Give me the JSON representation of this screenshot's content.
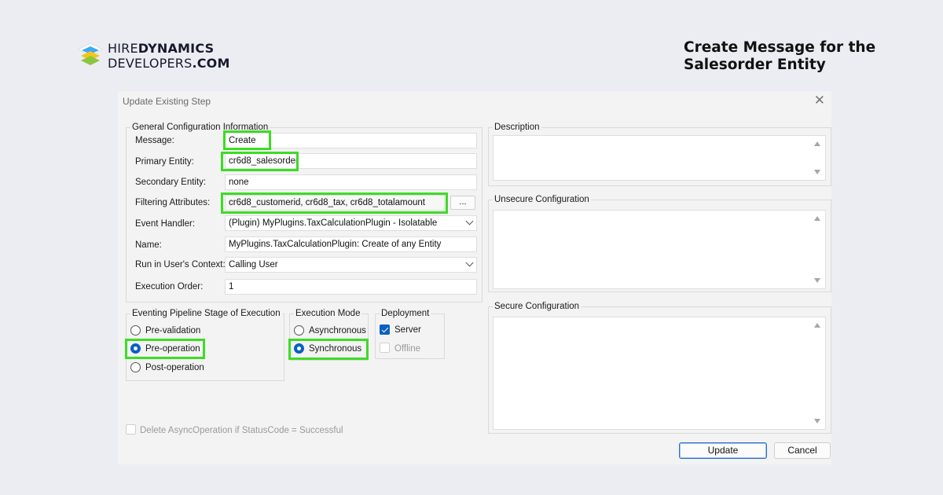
{
  "brand": {
    "line1_a": "HIRE",
    "line1_b": "DYNAMICS",
    "line2_a": "DEVELOPERS",
    "line2_b": ".COM"
  },
  "headline": "Create Message for the Salesorder Entity",
  "dialog": {
    "title": "Update Existing Step",
    "close_glyph": "✕",
    "general": {
      "legend": "General Configuration Information",
      "message_label": "Message:",
      "message_value": "Create",
      "primary_label": "Primary Entity:",
      "primary_value": "cr6d8_salesorder",
      "secondary_label": "Secondary Entity:",
      "secondary_value": "none",
      "filtering_label": "Filtering Attributes:",
      "filtering_value": "cr6d8_customerid, cr6d8_tax, cr6d8_totalamount",
      "filtering_button": "...",
      "handler_label": "Event Handler:",
      "handler_value": "(Plugin) MyPlugins.TaxCalculationPlugin - Isolatable",
      "name_label": "Name:",
      "name_value": "MyPlugins.TaxCalculationPlugin: Create of any Entity",
      "context_label": "Run in User's Context:",
      "context_value": "Calling User",
      "order_label": "Execution Order:",
      "order_value": "1"
    },
    "pipeline": {
      "legend": "Eventing Pipeline Stage of Execution",
      "options": [
        "Pre-validation",
        "Pre-operation",
        "Post-operation"
      ],
      "selected": "Pre-operation"
    },
    "mode": {
      "legend": "Execution Mode",
      "options": [
        "Asynchronous",
        "Synchronous"
      ],
      "selected": "Synchronous"
    },
    "deployment": {
      "legend": "Deployment",
      "server_label": "Server",
      "server_checked": true,
      "offline_label": "Offline",
      "offline_checked": false
    },
    "delete_async_label": "Delete AsyncOperation if StatusCode = Successful",
    "description_label": "Description",
    "unsecure_label": "Unsecure Configuration",
    "secure_label": "Secure Configuration",
    "update_button": "Update",
    "cancel_button": "Cancel"
  },
  "colors": {
    "highlight": "#3ddc24",
    "accent": "#0a5fc4",
    "background": "#ebedf3"
  },
  "icons": [
    "logo-mark-icon",
    "close-icon",
    "chevron-down-icon",
    "scroll-up-icon",
    "scroll-down-icon",
    "checkmark-icon"
  ]
}
